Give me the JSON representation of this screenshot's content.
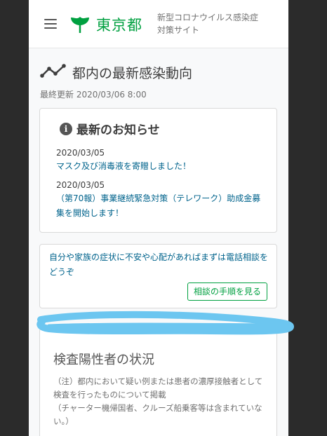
{
  "header": {
    "logo_text": "東京都",
    "site_title_line1": "新型コロナウイルス感染症",
    "site_title_line2": "対策サイト"
  },
  "page": {
    "title": "都内の最新感染動向",
    "last_updated": "最終更新 2020/03/06 8:00"
  },
  "news": {
    "heading": "最新のお知らせ",
    "items": [
      {
        "date": "2020/03/05",
        "text": "マスク及び消毒液を寄贈しました！"
      },
      {
        "date": "2020/03/05",
        "text": "（第70報）事業継続緊急対策（テレワーク）助成金募集を開始します！"
      }
    ]
  },
  "consult": {
    "text": "自分や家族の症状に不安や心配があればまずは電話相談をどうぞ",
    "button_label": "相談の手順を見る"
  },
  "status": {
    "title": "検査陽性者の状況",
    "note_line1": "（注）都内において疑い例または患者の濃厚接触者として検査を行ったものについて掲載",
    "note_line2": "（チャーター機帰国者、クルーズ船乗客等は含まれていない。）"
  },
  "colors": {
    "brand_green": "#00a040",
    "link_blue": "#00638c",
    "annotation_stroke": "#6cc6f0"
  }
}
